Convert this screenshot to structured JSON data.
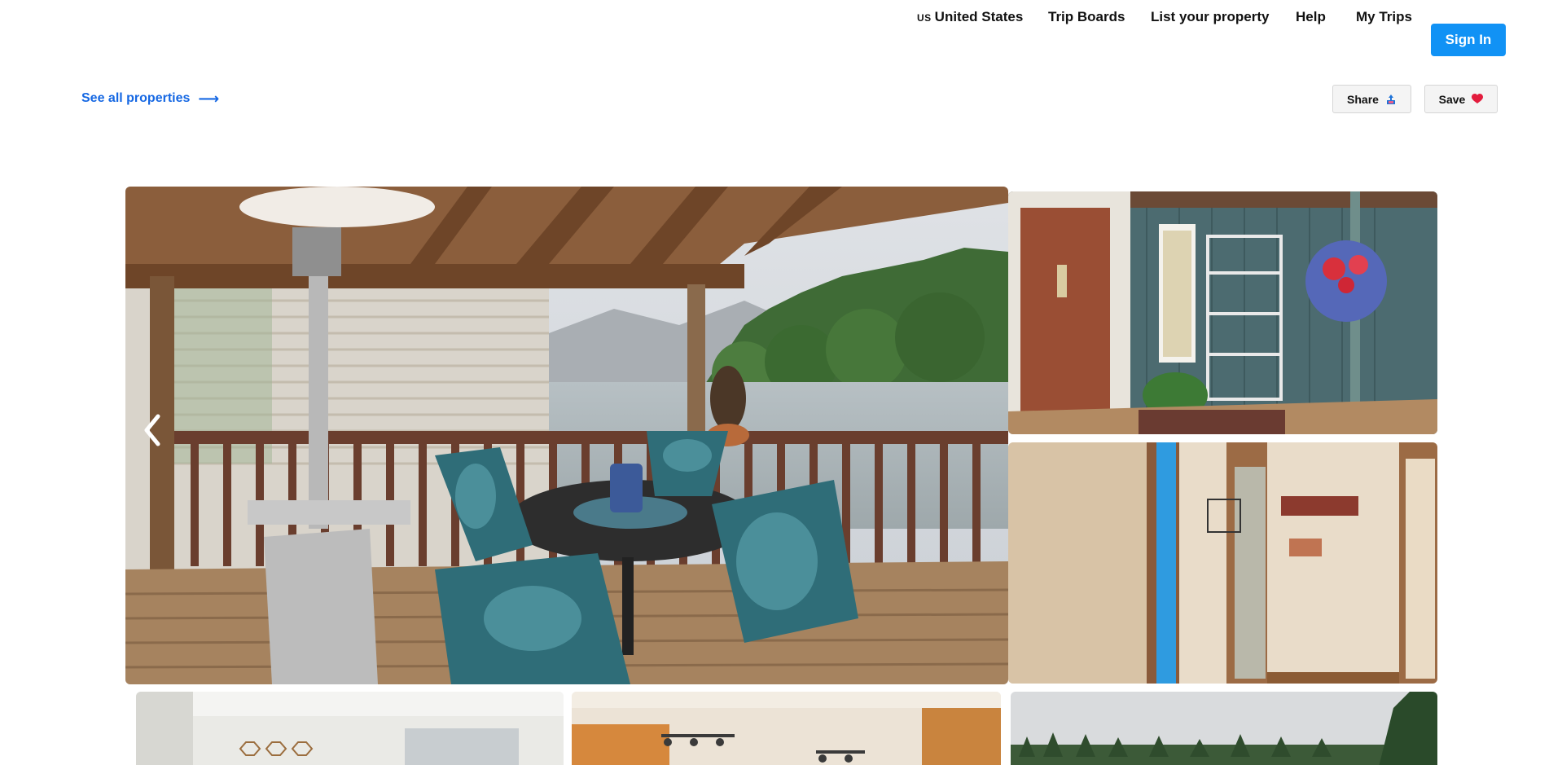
{
  "nav": {
    "country_code": "US",
    "country_label": "United States",
    "trip_boards": "Trip Boards",
    "list_property": "List your property",
    "help": "Help",
    "my_trips": "My Trips",
    "sign_in": "Sign In"
  },
  "subbar": {
    "see_all": "See all properties",
    "see_all_icon": "arrow-right-icon",
    "share_label": "Share",
    "share_icon": "share-icon",
    "save_label": "Save",
    "save_icon": "heart-icon"
  },
  "gallery": {
    "prev_icon": "chevron-left-icon",
    "photos": [
      {
        "name": "covered-deck-with-patio-table-and-river-view"
      },
      {
        "name": "front-entry-porch-with-hanging-flower-basket"
      },
      {
        "name": "entry-hallway-with-welcome-signs"
      },
      {
        "name": "bedroom-with-hexagon-shelves"
      },
      {
        "name": "living-room-with-track-lighting"
      },
      {
        "name": "outdoor-view-with-evergreen-trees"
      }
    ]
  },
  "colors": {
    "brand_blue": "#1192f5",
    "link_blue": "#1668e3",
    "heart_red": "#e31c3d"
  }
}
